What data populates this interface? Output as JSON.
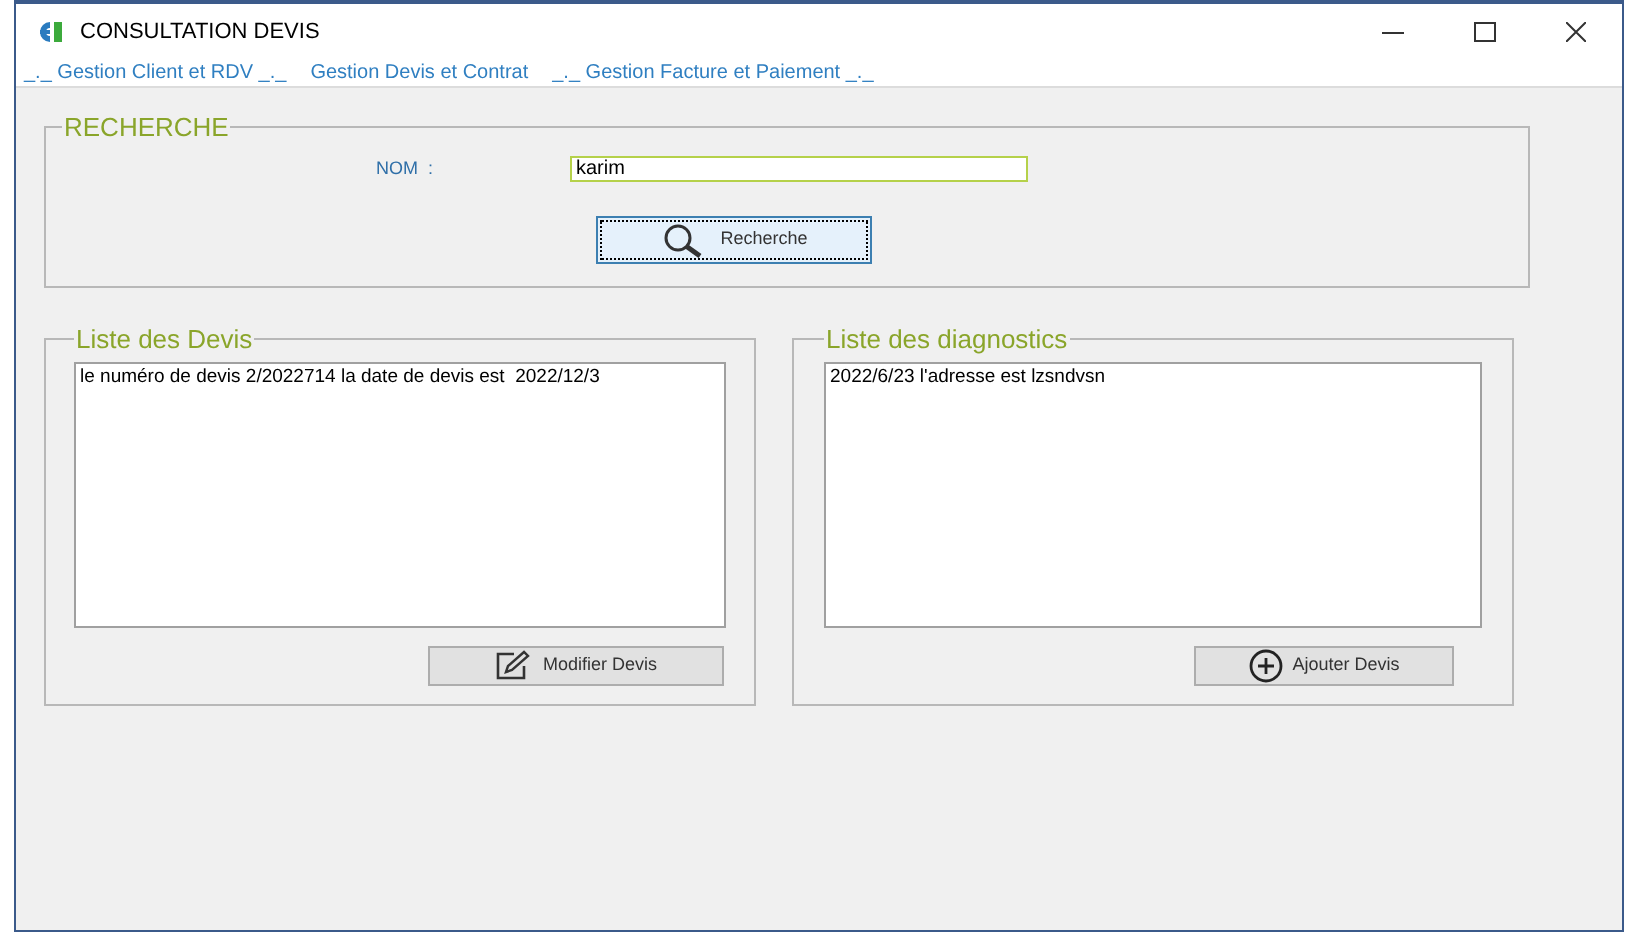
{
  "window": {
    "title": "CONSULTATION DEVIS"
  },
  "menu": [
    {
      "label": "_._ Gestion Client et RDV _._"
    },
    {
      "label": "Gestion Devis et Contrat"
    },
    {
      "label": "_._ Gestion Facture et Paiement _._"
    }
  ],
  "search": {
    "title": "RECHERCHE",
    "label": "NOM  :",
    "value": "karim",
    "button": "Recherche"
  },
  "devis": {
    "title": "Liste des Devis",
    "items": [
      "le numéro de devis 2/2022714 la date de devis est  2022/12/3"
    ],
    "button": "Modifier Devis"
  },
  "diagnostics": {
    "title": "Liste des diagnostics",
    "items": [
      "2022/6/23 l'adresse est lzsndvsn"
    ],
    "button": "Ajouter Devis"
  }
}
